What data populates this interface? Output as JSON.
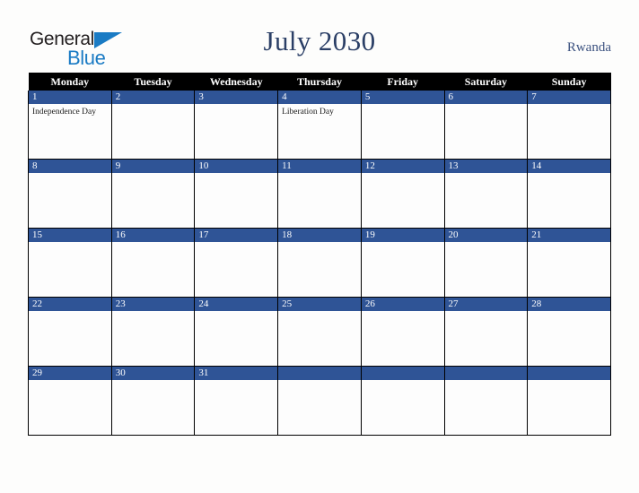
{
  "brand": {
    "name_part1": "General",
    "name_part2": "Blue",
    "triangle_color": "#1a7bc4",
    "text_color": "#231f20"
  },
  "header": {
    "title": "July 2030",
    "country": "Rwanda",
    "title_color": "#2b3f66",
    "country_color": "#3c5280"
  },
  "calendar": {
    "month": "July",
    "year": "2030",
    "accent_color": "#2f5496",
    "header_bg": "#000000",
    "weekdays": [
      "Monday",
      "Tuesday",
      "Wednesday",
      "Thursday",
      "Friday",
      "Saturday",
      "Sunday"
    ],
    "weeks": [
      [
        {
          "day": "1",
          "event": "Independence Day"
        },
        {
          "day": "2",
          "event": ""
        },
        {
          "day": "3",
          "event": ""
        },
        {
          "day": "4",
          "event": "Liberation Day"
        },
        {
          "day": "5",
          "event": ""
        },
        {
          "day": "6",
          "event": ""
        },
        {
          "day": "7",
          "event": ""
        }
      ],
      [
        {
          "day": "8",
          "event": ""
        },
        {
          "day": "9",
          "event": ""
        },
        {
          "day": "10",
          "event": ""
        },
        {
          "day": "11",
          "event": ""
        },
        {
          "day": "12",
          "event": ""
        },
        {
          "day": "13",
          "event": ""
        },
        {
          "day": "14",
          "event": ""
        }
      ],
      [
        {
          "day": "15",
          "event": ""
        },
        {
          "day": "16",
          "event": ""
        },
        {
          "day": "17",
          "event": ""
        },
        {
          "day": "18",
          "event": ""
        },
        {
          "day": "19",
          "event": ""
        },
        {
          "day": "20",
          "event": ""
        },
        {
          "day": "21",
          "event": ""
        }
      ],
      [
        {
          "day": "22",
          "event": ""
        },
        {
          "day": "23",
          "event": ""
        },
        {
          "day": "24",
          "event": ""
        },
        {
          "day": "25",
          "event": ""
        },
        {
          "day": "26",
          "event": ""
        },
        {
          "day": "27",
          "event": ""
        },
        {
          "day": "28",
          "event": ""
        }
      ],
      [
        {
          "day": "29",
          "event": ""
        },
        {
          "day": "30",
          "event": ""
        },
        {
          "day": "31",
          "event": ""
        },
        {
          "day": "",
          "event": ""
        },
        {
          "day": "",
          "event": ""
        },
        {
          "day": "",
          "event": ""
        },
        {
          "day": "",
          "event": ""
        }
      ]
    ]
  }
}
